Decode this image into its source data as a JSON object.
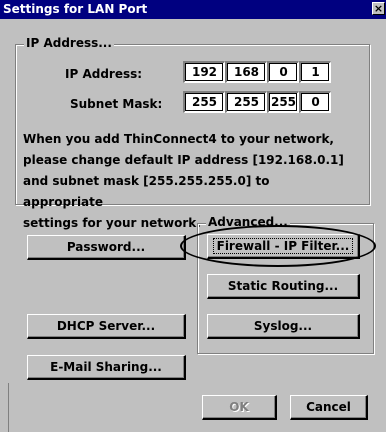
{
  "window": {
    "title": "Settings for LAN Port",
    "close_glyph": "×"
  },
  "ip_group": {
    "label": "IP Address...",
    "ip_label": "IP Address:",
    "ip_octets": [
      "192",
      "168",
      "0",
      "1"
    ],
    "mask_label": "Subnet Mask:",
    "mask_octets": [
      "255",
      "255",
      "255",
      "0"
    ]
  },
  "message": {
    "lines": [
      "When you add ThinConnect4 to your network,",
      "please change default IP address [192.168.0.1]",
      "and subnet mask [255.255.255.0] to appropriate",
      "settings for your network."
    ]
  },
  "buttons": {
    "password": "Password...",
    "dhcp": "DHCP Server...",
    "email": "E-Mail Sharing...",
    "ok": "OK",
    "cancel": "Cancel"
  },
  "advanced": {
    "label": "Advanced...",
    "firewall": "Firewall - IP Filter...",
    "routing": "Static Routing...",
    "syslog": "Syslog..."
  }
}
